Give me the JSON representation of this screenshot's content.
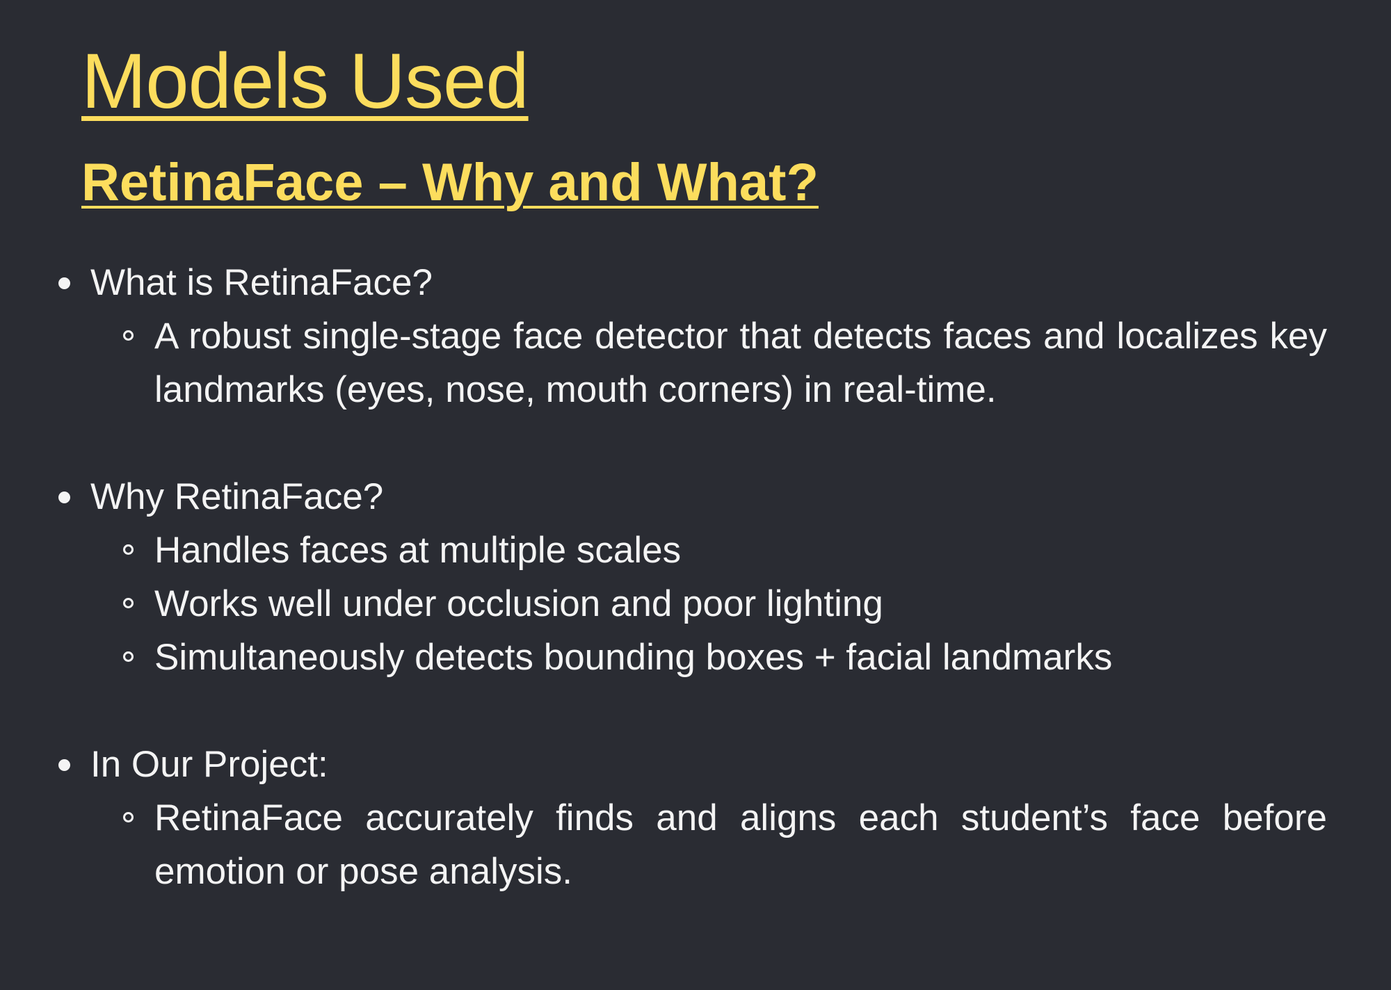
{
  "slide": {
    "title": "Models Used",
    "subtitle": "RetinaFace – Why and What?",
    "sections": [
      {
        "heading": "What is RetinaFace?",
        "items": [
          " A robust single-stage face detector that detects faces and localizes key landmarks (eyes, nose, mouth corners) in real-time."
        ]
      },
      {
        "heading": "Why RetinaFace?",
        "items": [
          "Handles faces at multiple scales",
          "Works well under occlusion and poor lighting",
          "Simultaneously detects bounding boxes + facial landmarks"
        ]
      },
      {
        "heading": "In Our Project:",
        "items": [
          " RetinaFace accurately finds and aligns each student’s face before emotion or pose analysis."
        ]
      }
    ]
  },
  "colors": {
    "background": "#2a2c33",
    "accent": "#fcdd5d",
    "text": "#f4f4f4"
  }
}
